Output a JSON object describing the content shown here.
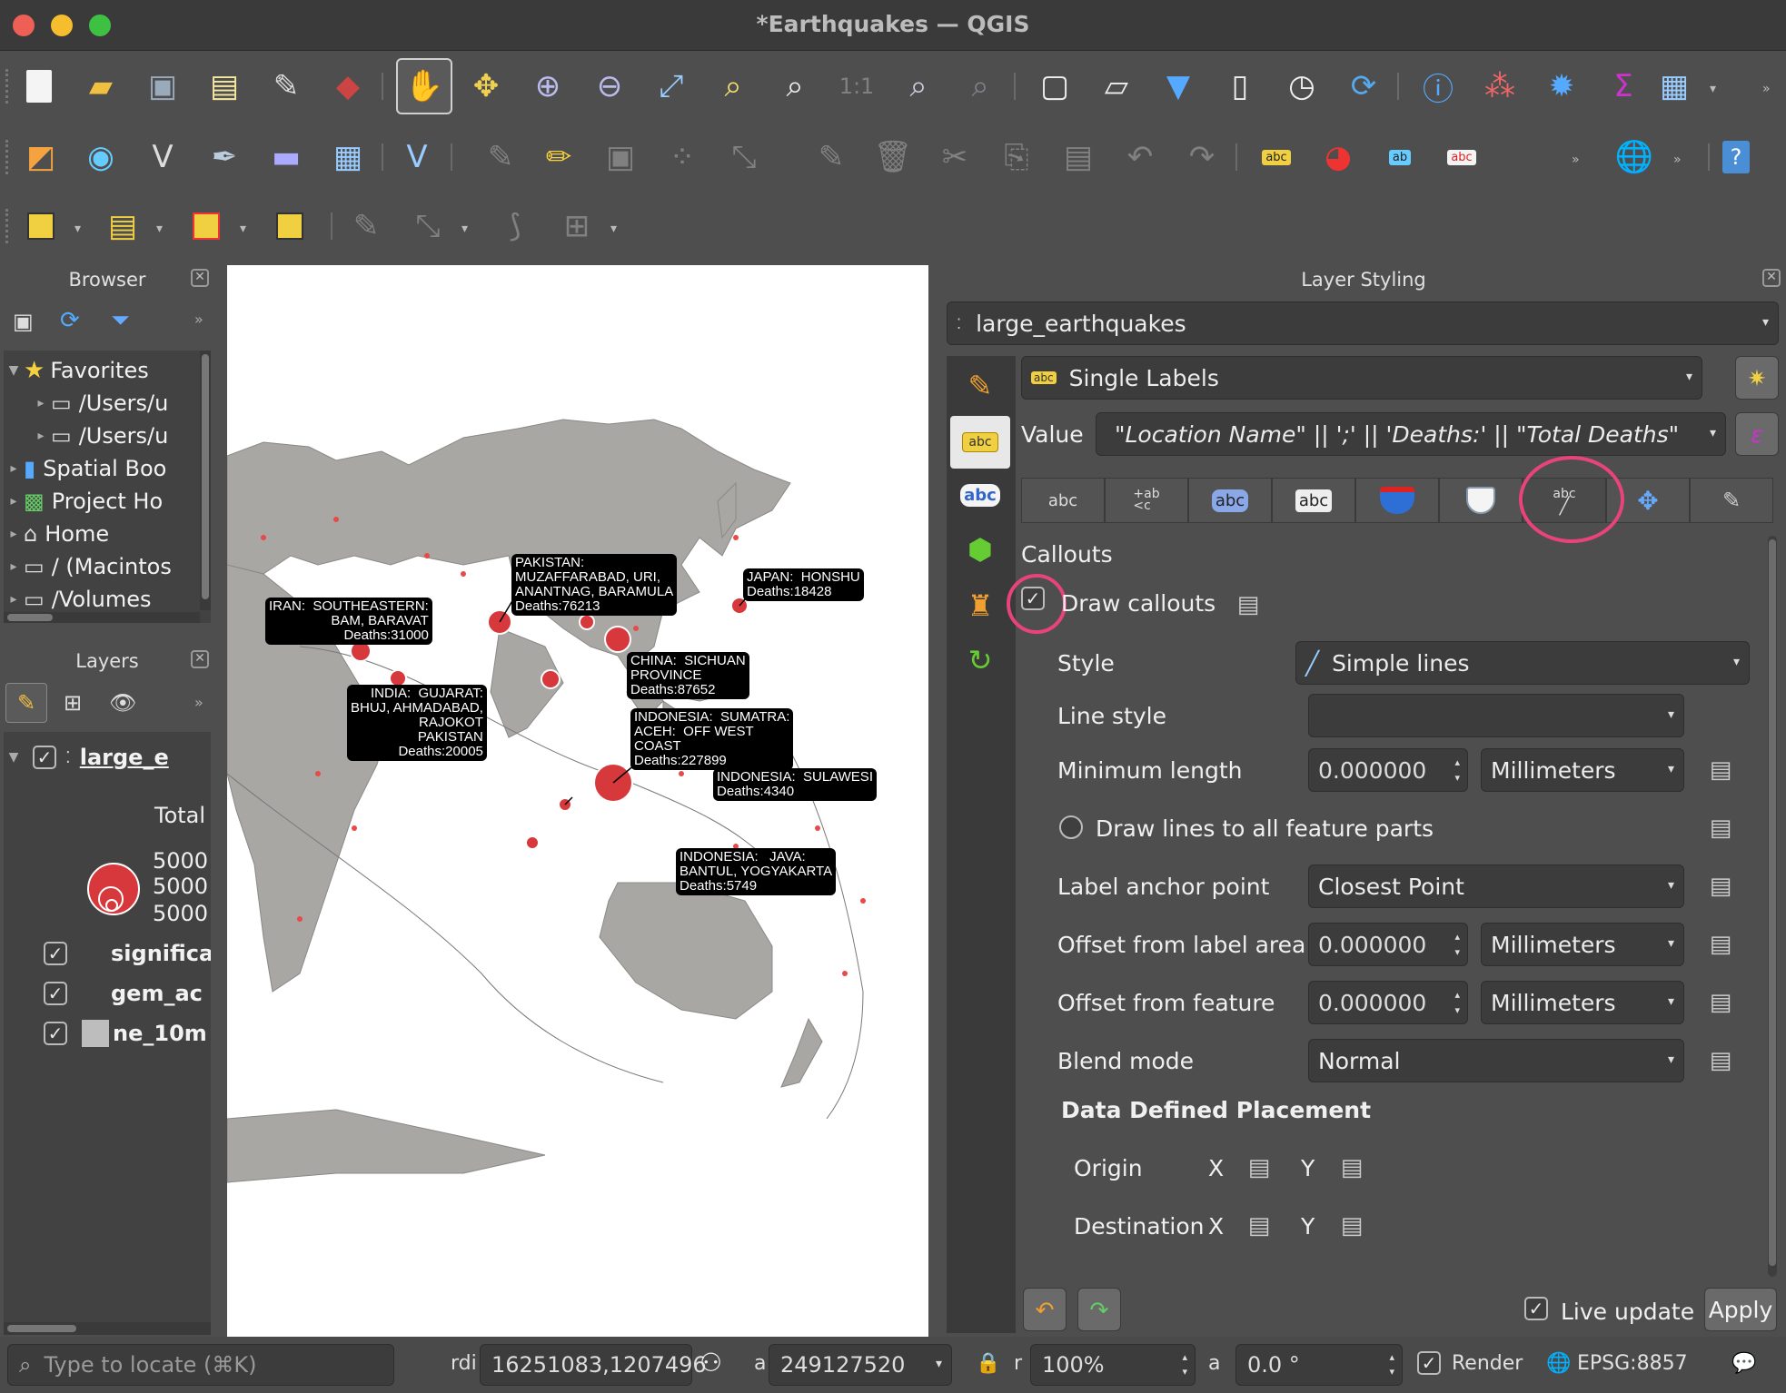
{
  "window": {
    "title": "*Earthquakes — QGIS"
  },
  "browser": {
    "title": "Browser",
    "items": [
      {
        "label": "Favorites"
      },
      {
        "label": "/Users/u"
      },
      {
        "label": "/Users/u"
      },
      {
        "label": "Spatial Boo"
      },
      {
        "label": "Project Ho"
      },
      {
        "label": "Home"
      },
      {
        "label": "/ (Macintos"
      },
      {
        "label": "/Volumes"
      }
    ]
  },
  "layers": {
    "title": "Layers",
    "items": [
      {
        "label": "large_e"
      },
      {
        "label": "significa"
      },
      {
        "label": "gem_ac"
      },
      {
        "label": "ne_10m"
      }
    ],
    "legend_title": "Total",
    "legend_values": [
      "5000",
      "5000",
      "5000"
    ]
  },
  "map": {
    "labels": [
      {
        "text": "PAKISTAN:\nMUZAFFARABAD, URI,\nANANTNAG, BARAMULA\nDeaths:76213"
      },
      {
        "text": "JAPAN:  HONSHU\nDeaths:18428"
      },
      {
        "text": "IRAN:  SOUTHEASTERN:\nBAM, BARAVAT\nDeaths:31000"
      },
      {
        "text": "CHINA:  SICHUAN\nPROVINCE\nDeaths:87652"
      },
      {
        "text": "INDIA:  GUJARAT:\nBHUJ, AHMADABAD,\nRAJOKOT\nPAKISTAN\nDeaths:20005"
      },
      {
        "text": "INDONESIA:  SUMATRA:\nACEH:  OFF WEST\nCOAST\nDeaths:227899"
      },
      {
        "text": "INDONESIA:  SULAWESI\nDeaths:4340"
      },
      {
        "text": "INDONESIA:   JAVA:\nBANTUL, YOGYAKARTA\nDeaths:5749"
      }
    ]
  },
  "styling": {
    "title": "Layer Styling",
    "layer_name": "large_earthquakes",
    "renderer": "Single Labels",
    "value_label": "Value",
    "value_expression": "\"Location Name\" || ';' || 'Deaths:' || \"Total Deaths\"",
    "tabs": [
      "abc",
      "+ab\n<c",
      "abc",
      "abc",
      "",
      "",
      "abc",
      "",
      ""
    ],
    "section_title": "Callouts",
    "draw_callouts_label": "Draw callouts",
    "draw_callouts_checked": true,
    "style_label": "Style",
    "style_value": "Simple lines",
    "line_style_label": "Line style",
    "min_length_label": "Minimum length",
    "min_length_value": "0.000000",
    "min_length_unit": "Millimeters",
    "draw_all_parts_label": "Draw lines to all feature parts",
    "anchor_label": "Label anchor point",
    "anchor_value": "Closest Point",
    "offset_label_label": "Offset from label area",
    "offset_label_value": "0.000000",
    "offset_label_unit": "Millimeters",
    "offset_feature_label": "Offset from feature",
    "offset_feature_value": "0.000000",
    "offset_feature_unit": "Millimeters",
    "blend_label": "Blend mode",
    "blend_value": "Normal",
    "ddp_title": "Data Defined Placement",
    "origin_label": "Origin",
    "destination_label": "Destination",
    "x_label": "X",
    "y_label": "Y",
    "live_update_label": "Live update",
    "apply_label": "Apply"
  },
  "status": {
    "locate_placeholder": "Type to locate (⌘K)",
    "coord_label": "rdi",
    "coord_value": "16251083,1207496",
    "scale_label": "a",
    "scale_value": "249127520",
    "mag_label": "r",
    "mag_value": "100%",
    "rot_label": "a",
    "rot_value": "0.0 °",
    "render_label": "Render",
    "crs": "EPSG:8857"
  }
}
